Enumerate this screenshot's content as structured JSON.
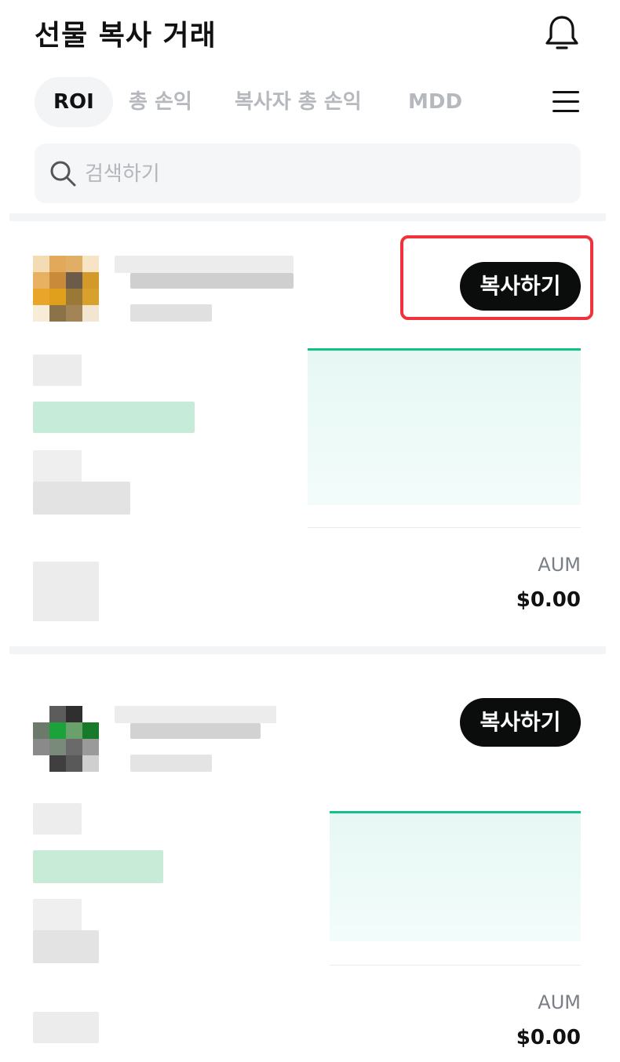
{
  "header": {
    "title": "선물 복사 거래",
    "bell_icon": "bell-icon"
  },
  "tabs": [
    {
      "label": "ROI",
      "active": true
    },
    {
      "label": "총 손익",
      "active": false
    },
    {
      "label": "복사자 총 손익",
      "active": false
    },
    {
      "label": "MDD",
      "active": false
    }
  ],
  "menu_icon": "hamburger-menu-icon",
  "search": {
    "placeholder": "검색하기",
    "value": ""
  },
  "cards": [
    {
      "copy_label": "복사하기",
      "aum_label": "AUM",
      "aum_value": "$0.00",
      "highlighted": true
    },
    {
      "copy_label": "복사하기",
      "aum_label": "AUM",
      "aum_value": "$0.00",
      "highlighted": false
    }
  ],
  "colors": {
    "accent_green": "#15c08b",
    "highlight_red": "#f0323c",
    "button_dark": "#0b0c0c"
  }
}
